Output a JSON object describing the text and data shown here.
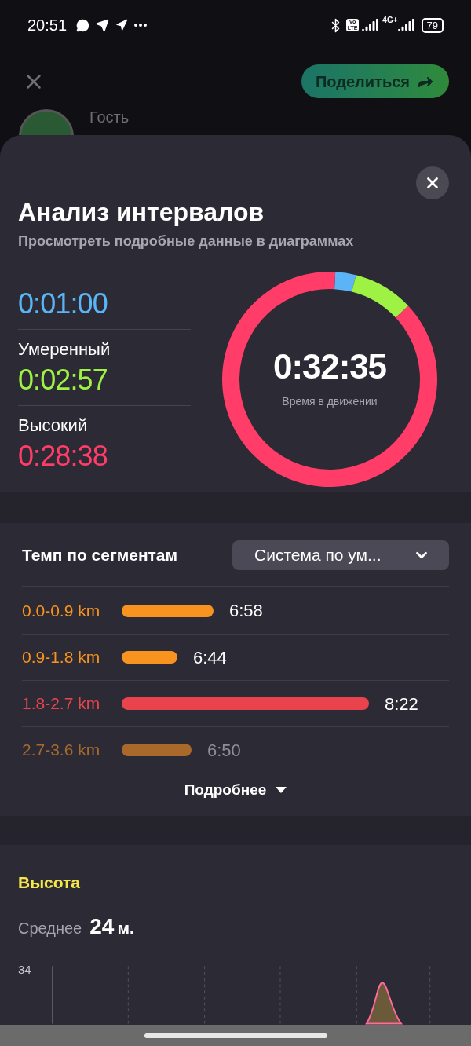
{
  "status_bar": {
    "time": "20:51",
    "volte": [
      "Vo",
      "LTE"
    ],
    "network": "4G+",
    "battery": "79"
  },
  "background": {
    "share_button": "Поделиться",
    "user_name": "Гость"
  },
  "sheet": {
    "title": "Анализ интервалов",
    "subtitle": "Просмотреть подробные данные в диаграммах"
  },
  "intervals": [
    {
      "time": "0:01:00",
      "color": "#5ab4f5"
    },
    {
      "label": "Умеренный",
      "time": "0:02:57",
      "color": "#9ef243"
    },
    {
      "label": "Высокий",
      "time": "0:28:38",
      "color": "#ff3d68"
    }
  ],
  "ring": {
    "total": "0:32:35",
    "caption": "Время в движении",
    "chart_data": {
      "type": "donut",
      "values": [
        3.1,
        9.1,
        87.8
      ]
    }
  },
  "pace": {
    "title": "Темп по сегментам",
    "dropdown": "Система по ум...",
    "rows": [
      {
        "label": "0.0-0.9 km",
        "value": "6:58",
        "color": "#f7931e",
        "dimmed": false
      },
      {
        "label": "0.9-1.8 km",
        "value": "6:44",
        "color": "#f7931e",
        "dimmed": false
      },
      {
        "label": "1.8-2.7 km",
        "value": "8:22",
        "color": "#e9444e",
        "dimmed": false
      },
      {
        "label": "2.7-3.6 km",
        "value": "6:50",
        "color": "#a8692a",
        "dimmed": true
      }
    ],
    "more": "Подробнее"
  },
  "elevation": {
    "title": "Высота",
    "average_label": "Среднее",
    "average_value": "24",
    "unit": "м.",
    "y_label": "34"
  }
}
